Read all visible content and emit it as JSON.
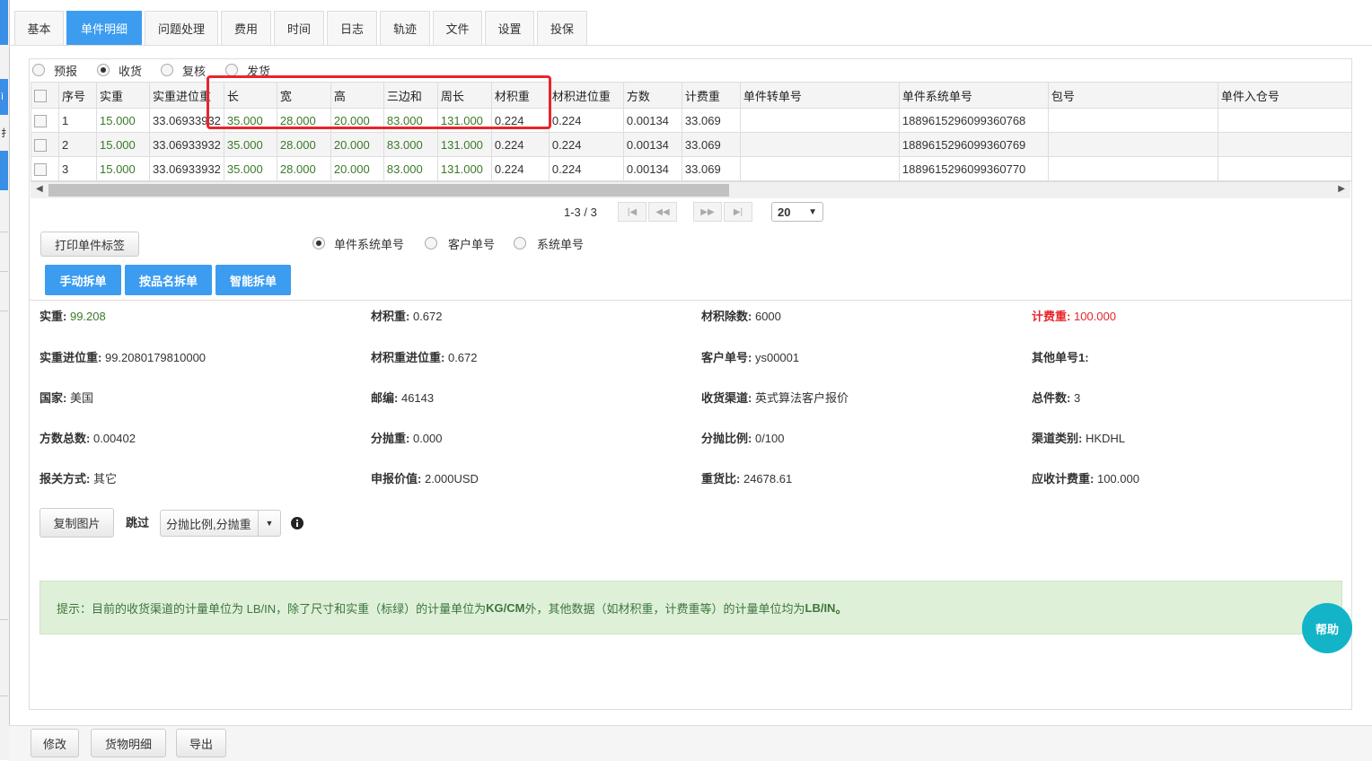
{
  "tabs": [
    "基本",
    "单件明细",
    "问题处理",
    "费用",
    "时间",
    "日志",
    "轨迹",
    "文件",
    "设置",
    "投保"
  ],
  "active_tab": "单件明细",
  "left_edge": {
    "char1": "ì",
    "char2": "扌"
  },
  "status_radios": [
    {
      "label": "预报",
      "checked": false
    },
    {
      "label": "收货",
      "checked": true
    },
    {
      "label": "复核",
      "checked": false
    },
    {
      "label": "发货",
      "checked": false
    }
  ],
  "grid": {
    "headers": [
      "序号",
      "实重",
      "实重进位重",
      "长",
      "宽",
      "高",
      "三边和",
      "周长",
      "材积重",
      "材积进位重",
      "方数",
      "计费重",
      "单件转单号",
      "单件系统单号",
      "包号",
      "单件入仓号"
    ],
    "rows": [
      [
        "1",
        "15.000",
        "33.06933932",
        "35.000",
        "28.000",
        "20.000",
        "83.000",
        "131.000",
        "0.224",
        "0.224",
        "0.00134",
        "33.069",
        "",
        "1889615296099360768",
        "",
        ""
      ],
      [
        "2",
        "15.000",
        "33.06933932",
        "35.000",
        "28.000",
        "20.000",
        "83.000",
        "131.000",
        "0.224",
        "0.224",
        "0.00134",
        "33.069",
        "",
        "1889615296099360769",
        "",
        ""
      ],
      [
        "3",
        "15.000",
        "33.06933932",
        "35.000",
        "28.000",
        "20.000",
        "83.000",
        "131.000",
        "0.224",
        "0.224",
        "0.00134",
        "33.069",
        "",
        "1889615296099360770",
        "",
        ""
      ]
    ]
  },
  "pager": {
    "range": "1-3 / 3",
    "page_size": "20"
  },
  "print_label_button": "打印单件标签",
  "label_type_radios": [
    {
      "label": "单件系统单号",
      "checked": true
    },
    {
      "label": "客户单号",
      "checked": false
    },
    {
      "label": "系统单号",
      "checked": false
    }
  ],
  "split_buttons": [
    "手动拆单",
    "按品名拆单",
    "智能拆单"
  ],
  "info": [
    {
      "label": "实重:",
      "value": "99.208",
      "style": "green"
    },
    {
      "label": "材积重:",
      "value": "0.672",
      "style": ""
    },
    {
      "label": "材积除数:",
      "value": "6000",
      "style": ""
    },
    {
      "label": "计费重:",
      "value": "100.000",
      "style": "red"
    },
    {
      "label": "实重进位重:",
      "value": "99.2080179810000",
      "style": ""
    },
    {
      "label": "材积重进位重:",
      "value": "0.672",
      "style": ""
    },
    {
      "label": "客户单号:",
      "value": "ys00001",
      "style": ""
    },
    {
      "label": "其他单号1:",
      "value": "",
      "style": ""
    },
    {
      "label": "国家:",
      "value": "美国",
      "style": ""
    },
    {
      "label": "邮编:",
      "value": "46143",
      "style": ""
    },
    {
      "label": "收货渠道:",
      "value": "英式算法客户报价",
      "style": ""
    },
    {
      "label": "总件数:",
      "value": "3",
      "style": ""
    },
    {
      "label": "方数总数:",
      "value": "0.00402",
      "style": ""
    },
    {
      "label": "分抛重:",
      "value": "0.000",
      "style": ""
    },
    {
      "label": "分抛比例:",
      "value": "0/100",
      "style": ""
    },
    {
      "label": "渠道类别:",
      "value": "HKDHL",
      "style": ""
    },
    {
      "label": "报关方式:",
      "value": "其它",
      "style": ""
    },
    {
      "label": "申报价值:",
      "value": "2.000USD",
      "style": ""
    },
    {
      "label": "重货比:",
      "value": "24678.61",
      "style": ""
    },
    {
      "label": "应收计费重:",
      "value": "100.000",
      "style": ""
    }
  ],
  "copy_image_button": "复制图片",
  "skip_label": "跳过",
  "skip_select_value": "分抛比例,分抛重",
  "alert": {
    "prefix": "提示：目前的收货渠道的计量单位为 LB/IN，除了尺寸和实重（标绿）的计量单位为 ",
    "unit1": "KG/CM",
    "middle": " 外，其他数据（如材积重，计费重等）的计量单位均为 ",
    "unit2": "LB/IN",
    "suffix": " 。"
  },
  "help_button": "帮助",
  "footer_buttons": [
    "修改",
    "货物明细",
    "导出"
  ]
}
